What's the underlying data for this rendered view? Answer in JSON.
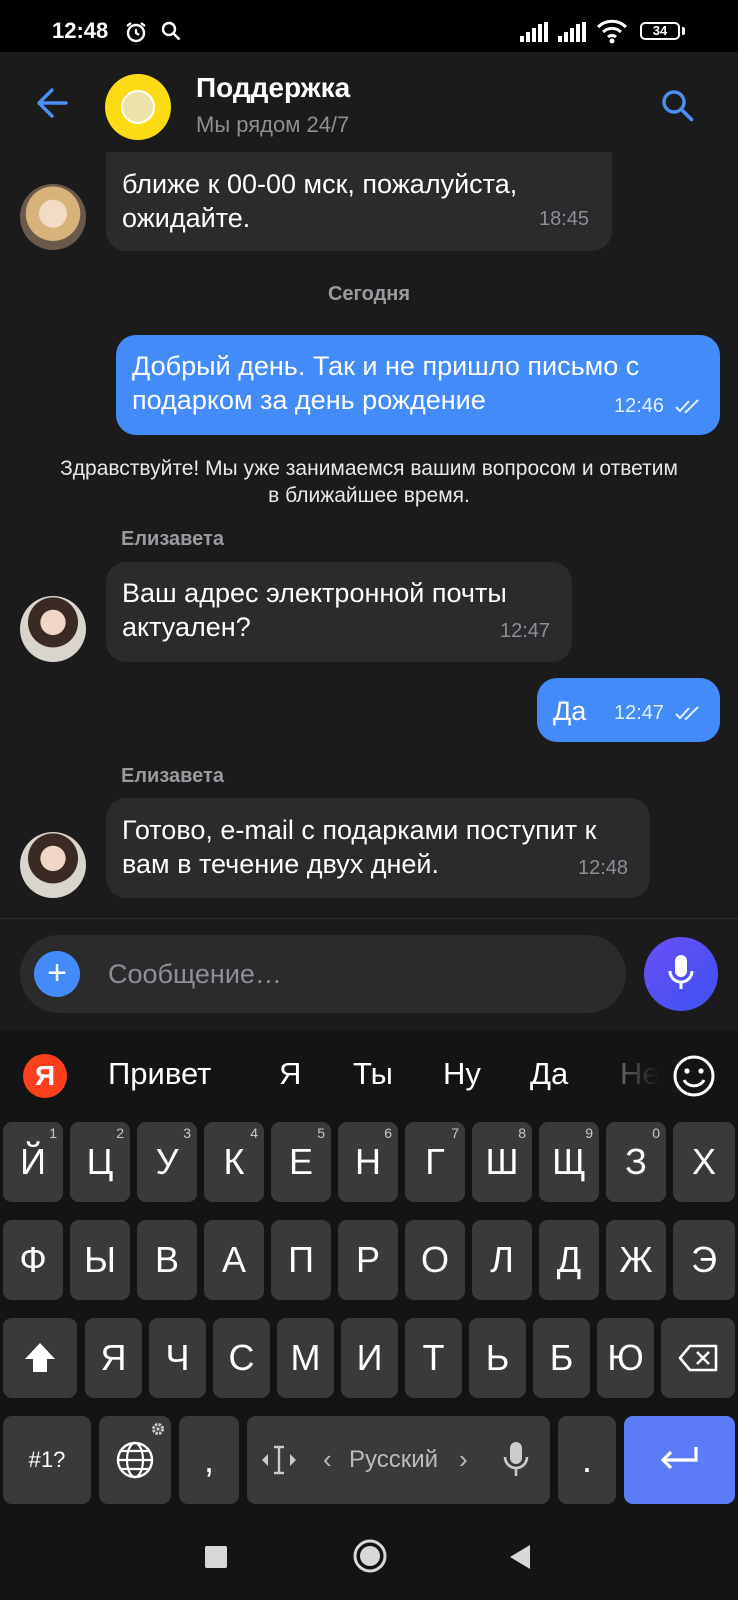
{
  "status_bar": {
    "time": "12:48",
    "battery": "34"
  },
  "header": {
    "title": "Поддержка",
    "subtitle": "Мы рядом 24/7"
  },
  "messages": [
    {
      "text": "ближе к 00-00 мск, пожалуйста, ожидайте.",
      "time": "18:45"
    },
    {
      "date_separator": "Сегодня"
    },
    {
      "text": "Добрый день. Так и не пришло письмо с подарком за день рождение",
      "time": "12:46"
    },
    {
      "system": "Здравствуйте! Мы уже занимаемся вашим вопросом и ответим в ближайшее время."
    },
    {
      "sender": "Елизавета",
      "text": "Ваш адрес электронной почты актуален?",
      "time": "12:47"
    },
    {
      "text": "Да",
      "time": "12:47"
    },
    {
      "sender": "Елизавета",
      "text": "Готово, e-mail с подарками поступит к вам в течение двух дней.",
      "time": "12:48"
    }
  ],
  "composer": {
    "placeholder": "Сообщение…"
  },
  "keyboard": {
    "logo": "Я",
    "suggestions": [
      "Привет",
      "Я",
      "Ты",
      "Ну",
      "Да",
      "Не"
    ],
    "row1": [
      {
        "k": "Й",
        "s": "1"
      },
      {
        "k": "Ц",
        "s": "2"
      },
      {
        "k": "У",
        "s": "3"
      },
      {
        "k": "К",
        "s": "4"
      },
      {
        "k": "Е",
        "s": "5"
      },
      {
        "k": "Н",
        "s": "6"
      },
      {
        "k": "Г",
        "s": "7"
      },
      {
        "k": "Ш",
        "s": "8"
      },
      {
        "k": "Щ",
        "s": "9"
      },
      {
        "k": "З",
        "s": "0"
      },
      {
        "k": "Х",
        "s": ""
      }
    ],
    "row2": [
      "Ф",
      "Ы",
      "В",
      "А",
      "П",
      "Р",
      "О",
      "Л",
      "Д",
      "Ж",
      "Э"
    ],
    "row3": [
      "Я",
      "Ч",
      "С",
      "М",
      "И",
      "Т",
      "Ь",
      "Б",
      "Ю"
    ],
    "symbols_key": "#1?",
    "comma_key": ",",
    "space_label": "Русский",
    "period_key": "."
  },
  "colors": {
    "accent": "#428bf9",
    "incoming_bubble": "#2b2b2e",
    "logo_yellow": "#fadb14"
  },
  "icons": [
    "back-arrow-icon",
    "search-icon",
    "plus-icon",
    "microphone-icon",
    "emoji-icon",
    "shift-icon",
    "backspace-icon",
    "globe-icon",
    "cursor-icon",
    "enter-icon"
  ]
}
